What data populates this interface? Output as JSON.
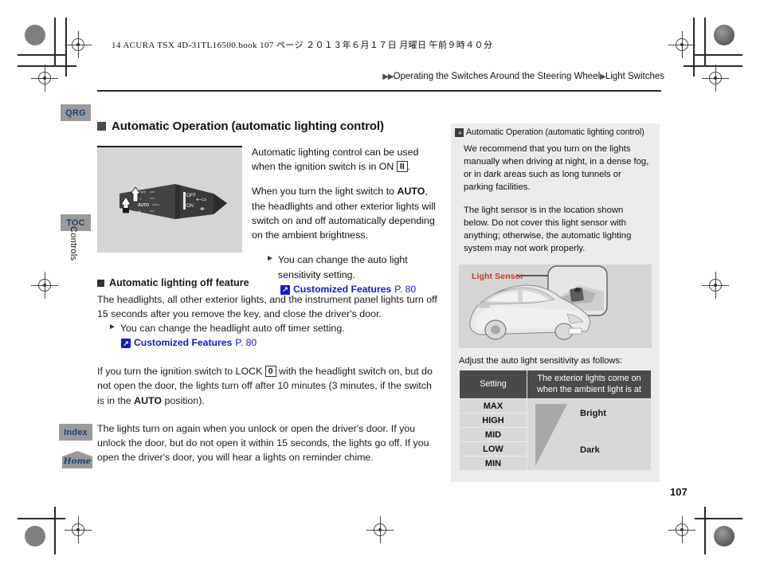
{
  "header": {
    "book_line": "14 ACURA TSX 4D-31TL16500.book   107 ページ   ２０１３年６月１７日   月曜日   午前９時４０分",
    "breadcrumb_chevrons": "▶▶",
    "breadcrumb_part1": "Operating the Switches Around the Steering Wheel",
    "breadcrumb_sep": "▶",
    "breadcrumb_part2": "Light Switches"
  },
  "left_tabs": {
    "qrg": "QRG",
    "toc": "TOC",
    "vertical_label": "Controls",
    "index": "Index",
    "home": "Home"
  },
  "main": {
    "section_title": "Automatic Operation (automatic lighting control)",
    "intro_p1_a": "Automatic lighting control can be used when the ignition switch is in ON ",
    "intro_p1_key": "II",
    "intro_p1_b": ".",
    "intro_p2_a": "When you turn the light switch to ",
    "intro_p2_bold": "AUTO",
    "intro_p2_b": ", the headlights and other exterior lights will switch on and off automatically depending on the ambient brightness.",
    "bullet1": "You can change the auto light sensitivity setting.",
    "link1_label": "Customized Features",
    "link1_page": "P. 80",
    "subsection_title": "Automatic lighting off feature",
    "sub_p1": "The headlights, all other exterior lights, and the instrument panel lights turn off 15 seconds after you remove the key, and close the driver's door.",
    "bullet2": "You can change the headlight auto off timer setting.",
    "link2_label": "Customized Features",
    "link2_page": "P. 80",
    "p_lock_a": "If you turn the ignition switch to LOCK ",
    "p_lock_key": "0",
    "p_lock_b": " with the headlight switch on, but do not open the door, the lights turn off after 10 minutes (3 minutes, if the switch is in the ",
    "p_lock_bold": "AUTO",
    "p_lock_c": " position).",
    "p_last": "The lights turn on again when you unlock or open the driver's door. If you unlock the door, but do not open it within 15 seconds, the lights go off. If you open the driver's door, you will hear a lights on reminder chime."
  },
  "sidebar": {
    "marker": "»",
    "title": "Automatic Operation (automatic lighting control)",
    "p1": "We recommend that you turn on the lights manually when driving at night, in a dense fog, or in dark areas such as long tunnels or parking facilities.",
    "p2": "The light sensor is in the location shown below. Do not cover this light sensor with anything; otherwise, the automatic lighting system may not work properly.",
    "light_sensor_label": "Light Sensor",
    "adjust_text": "Adjust the auto light sensitivity as follows:",
    "accent_red": "#c0392b"
  },
  "table": {
    "header_setting": "Setting",
    "header_desc": "The exterior lights come on when the ambient light is at",
    "rows": [
      "MAX",
      "HIGH",
      "MID",
      "LOW",
      "MIN"
    ],
    "label_bright": "Bright",
    "label_dark": "Dark"
  },
  "footer": {
    "page_number": "107"
  }
}
